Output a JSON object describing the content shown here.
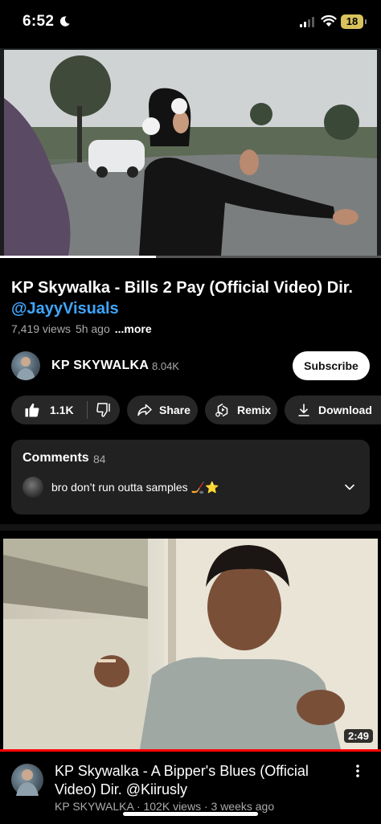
{
  "status_bar": {
    "time": "6:52",
    "battery": "18"
  },
  "player": {
    "progress_fraction": 0.41
  },
  "video": {
    "title": "KP Skywalka - Bills 2 Pay (Official Video) Dir.",
    "title_link": "@JayyVisuals",
    "views": "7,419 views",
    "age": "5h ago",
    "more_label": "...more"
  },
  "channel": {
    "name": "KP SKYWALKA",
    "subscribers": "8.04K",
    "subscribe_label": "Subscribe"
  },
  "actions": {
    "like_count": "1.1K",
    "share_label": "Share",
    "remix_label": "Remix",
    "download_label": "Download"
  },
  "comments": {
    "heading": "Comments",
    "count": "84",
    "top_comment": "bro don’t run outta samples 🏒⭐"
  },
  "next_video": {
    "title": "KP Skywalka - A Bipper's Blues (Official Video) Dir. @Kiirusly",
    "meta": "KP SKYWALKA · 102K views · 3 weeks ago",
    "duration": "2:49"
  },
  "icons": [
    "moon-icon",
    "signal-icon",
    "wifi-icon",
    "thumbs-up-icon",
    "thumbs-down-icon",
    "share-icon",
    "remix-icon",
    "download-icon",
    "chevron-down-icon",
    "more-vert-icon"
  ],
  "colors": {
    "link": "#3ea6ff",
    "chip_bg": "#272727",
    "progress_red": "#ff0000",
    "battery": "#d9c25c"
  }
}
